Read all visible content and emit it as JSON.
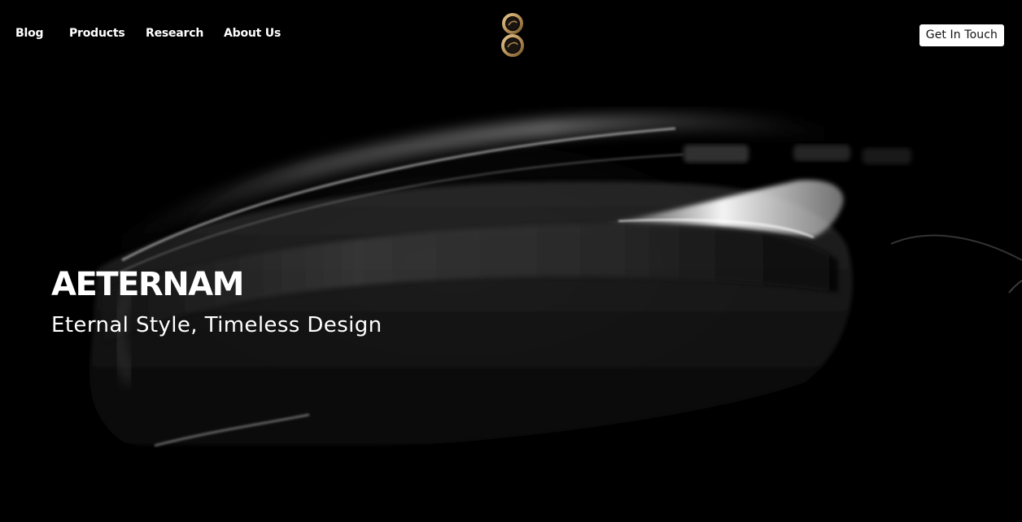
{
  "nav": {
    "links": [
      "Blog",
      "Products",
      "Research",
      "About Us"
    ],
    "cta_label": "Get In Touch"
  },
  "logo": {
    "icon": "infinity-ring-logo-icon",
    "colors": {
      "gold": "#b8925a",
      "dark": "#1a1410"
    }
  },
  "hero": {
    "title": "AETERNAM",
    "subtitle": "Eternal Style, Timeless Design",
    "background_icon": "watch-closeup-image"
  },
  "colors": {
    "background": "#000000",
    "text": "#ffffff",
    "cta_bg": "#ffffff",
    "cta_text": "#111111"
  }
}
